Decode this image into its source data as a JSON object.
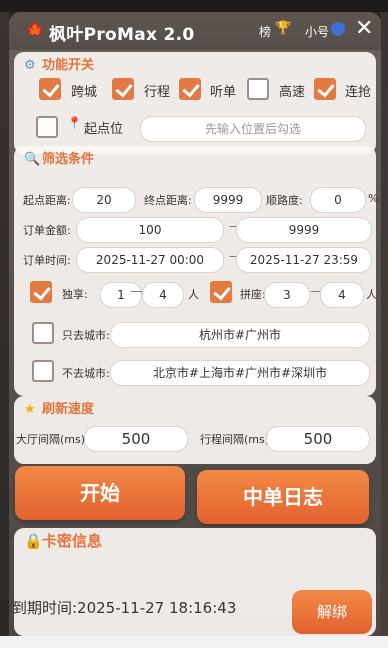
{
  "app": {
    "title": "枫叶ProMax 2.0",
    "rank_label": "榜",
    "mini_label": "小号",
    "close": "✕"
  },
  "features": {
    "title": "功能开关",
    "items": [
      {
        "label": "跨城",
        "checked": true
      },
      {
        "label": "行程",
        "checked": true
      },
      {
        "label": "听单",
        "checked": true
      },
      {
        "label": "高速",
        "checked": false
      },
      {
        "label": "连抢",
        "checked": true
      }
    ],
    "start_point_label": "起点位",
    "start_point_checked": false,
    "start_point_placeholder": "先输入位置后勾选"
  },
  "filters": {
    "title": "筛选条件",
    "start_distance_label": "起点距离:",
    "start_distance": "20",
    "end_distance_label": "终点距离:",
    "end_distance": "9999",
    "route_match_label": "顺路度:",
    "route_match": "0",
    "percent": "%",
    "amount_label": "订单金额:",
    "amount_min": "100",
    "amount_max": "9999",
    "time_label": "订单时间:",
    "time_start": "2025-11-27 00:00",
    "time_end": "2025-11-27 23:59",
    "exclusive_label": "独享:",
    "exclusive_checked": true,
    "exclusive_min": "1",
    "exclusive_max": "4",
    "person_unit": "人",
    "carpool_label": "拼座:",
    "carpool_checked": true,
    "carpool_min": "3",
    "carpool_max": "4",
    "only_city_label": "只去城市:",
    "only_city_checked": false,
    "only_city_value": "杭州市#广州市",
    "exclude_city_label": "不去城市:",
    "exclude_city_checked": false,
    "exclude_city_value": "北京市#上海市#广州市#深圳市",
    "dash": "—"
  },
  "refresh": {
    "title": "刷新速度",
    "hall_interval_label": "大厅间隔(ms)",
    "hall_interval": "500",
    "trip_interval_label": "行程间隔(ms)",
    "trip_interval": "500"
  },
  "actions": {
    "start_label": "开始",
    "log_label": "中单日志"
  },
  "license": {
    "title": "卡密信息",
    "expire_text": "到期时间:2025-11-27 18:16:43",
    "unbind_label": "解绑"
  },
  "colors": {
    "accent": "#e2763d",
    "checked": "#e27a42"
  }
}
